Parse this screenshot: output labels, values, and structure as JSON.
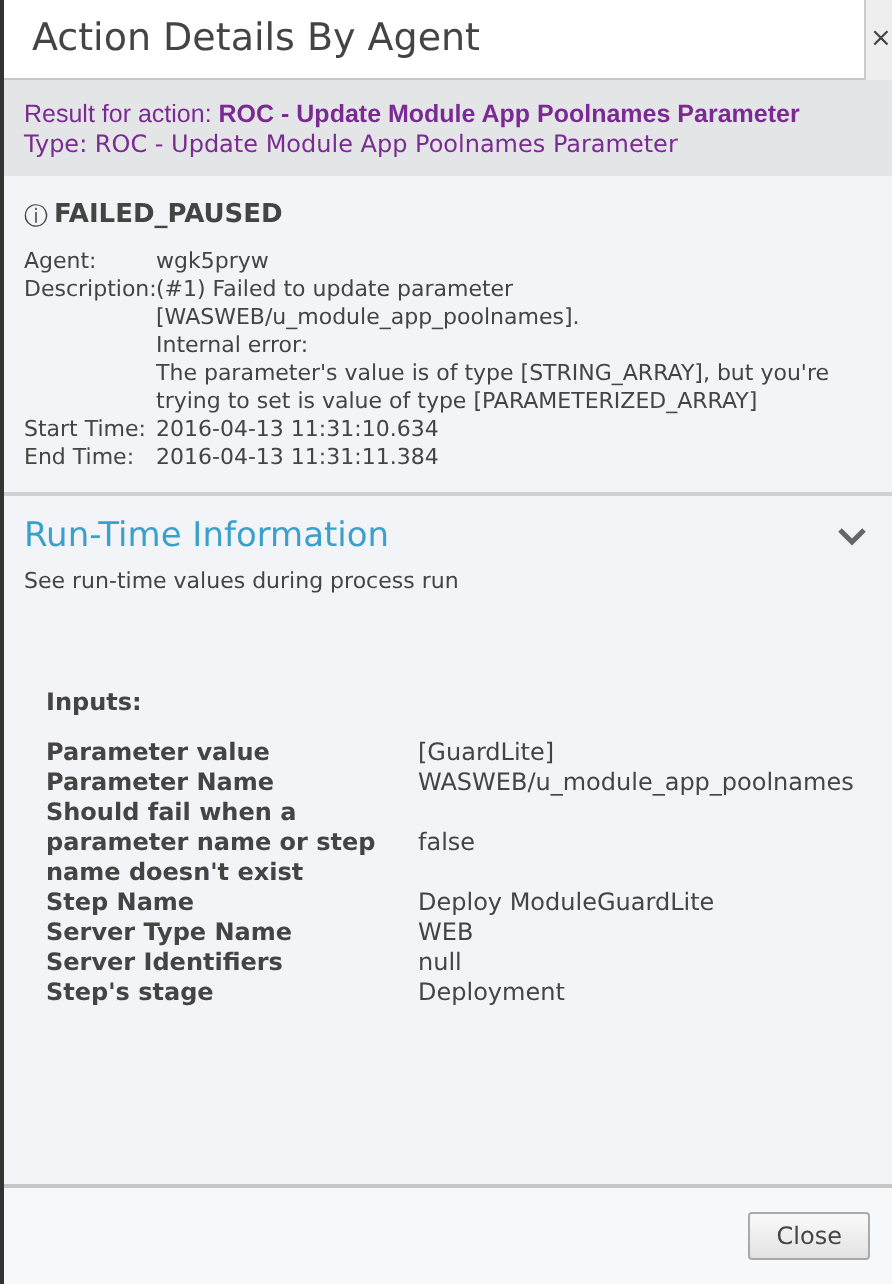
{
  "window": {
    "title": "Action Details By Agent",
    "close": "×"
  },
  "header": {
    "result_label": "Result for action:",
    "result_value": "ROC - Update Module App Poolnames Parameter",
    "type_line": "Type: ROC - Update Module App Poolnames Parameter"
  },
  "status": {
    "icon": "ⓘ",
    "text": "FAILED_PAUSED"
  },
  "details": [
    {
      "label": "Agent:",
      "lines": [
        "wgk5pryw"
      ]
    },
    {
      "label": "Description:",
      "lines": [
        "(#1) Failed to update parameter",
        "[WASWEB/u_module_app_poolnames].",
        "Internal error:",
        "The parameter's value is of type [STRING_ARRAY], but you're",
        "trying to set is value of type [PARAMETERIZED_ARRAY]"
      ]
    },
    {
      "label": "Start Time:",
      "lines": [
        "2016-04-13 11:31:10.634"
      ]
    },
    {
      "label": "End Time:",
      "lines": [
        "2016-04-13 11:31:11.384"
      ]
    }
  ],
  "runtime": {
    "title": "Run-Time Information",
    "subtitle": "See run-time values during process run",
    "expanded": true,
    "inputs_title": "Inputs:",
    "inputs": [
      {
        "name": "Parameter value",
        "value": "[GuardLite]"
      },
      {
        "name": "Parameter Name",
        "value": "WASWEB/u_module_app_poolnames"
      },
      {
        "name": "Should fail when a parameter name or step name doesn't exist",
        "value": "false"
      },
      {
        "name": "Step Name",
        "value": "Deploy ModuleGuardLite"
      },
      {
        "name": "Server Type Name",
        "value": "WEB"
      },
      {
        "name": "Server Identifiers",
        "value": "null"
      },
      {
        "name": "Step's stage",
        "value": "Deployment"
      }
    ]
  },
  "buttons": [
    "Close"
  ]
}
